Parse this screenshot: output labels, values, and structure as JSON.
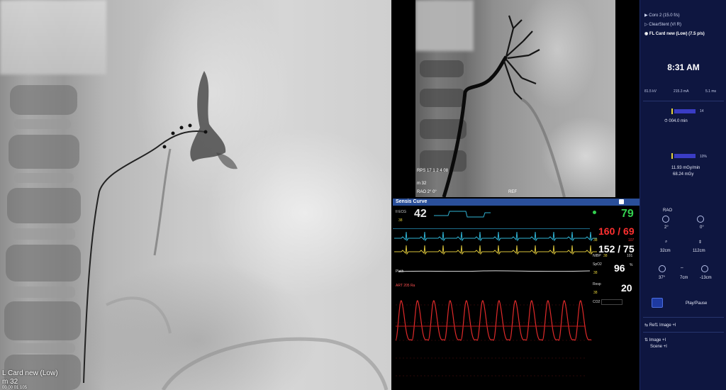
{
  "live_image": {
    "protocol_label": "L Card new (Low)",
    "distance_label": "m 32",
    "date_label": "00 00 01 105"
  },
  "reference_image": {
    "overlay_line1": "RPS 17 1 2 4 08",
    "overlay_line2": "m 32",
    "overlay_line3": "RAO 2° 0°",
    "ref_tag": "REF"
  },
  "monitor": {
    "title": "Sensis Curve",
    "ecg_label": "II ECG",
    "hr_value": "42",
    "hr_alarm": "38",
    "spo2_pulse": "79",
    "art_value": "160 / 69",
    "art_alarm_low": "38",
    "art_alarm_high": "107",
    "nibp_label": "NIBP",
    "nibp_value": "152 / 75",
    "nibp_mean_a": "38",
    "nibp_mean_b": "101",
    "spo2_label": "SpO2",
    "spo2_value": "96",
    "spo2_unit": "%",
    "spo2_alarm": "38",
    "resp_label": "Resp",
    "resp_value": "20",
    "resp_alarm": "38",
    "pleth_label": "Pleth",
    "art_wave_label": "ART  205  Ra",
    "co2_label": "CO2",
    "colors": {
      "hr": "#e8e8e8",
      "spo2": "#33d04f",
      "art": "#ff3030",
      "nibp": "#ffffff",
      "ecg_wave": "#d8c23a",
      "pleth_wave": "#2fb3d4",
      "art_wave": "#e02a2a"
    }
  },
  "sidebar": {
    "program_1": "Coro 2 (15.0 f/s)",
    "program_2": "ClearStent (VI R)",
    "program_3": "FL Card new (Low) (7.5 p/s)",
    "time": "8:31 AM",
    "kv": "81.5 kV",
    "ma": "215.3 mA",
    "ms": "5.1 ms",
    "fluoro_bar_max": "14",
    "fluoro_time": "004.0 min",
    "dose_bar_max": "10%",
    "dose_rate": "11.93 mGy/min",
    "dose_total": "68.24 mGy",
    "projection_label": "RAO",
    "angle_1": "2°",
    "angle_2": "0°",
    "zoom_1": "32cm",
    "zoom_2": "112cm",
    "table_1": "37°",
    "table_2": "7cm",
    "table_3": "-13cm",
    "play_pause": "Play/Pause",
    "ref_image": "Ref1 Image +I",
    "image_label": "Image +I",
    "scene_label": "Scene +I"
  }
}
